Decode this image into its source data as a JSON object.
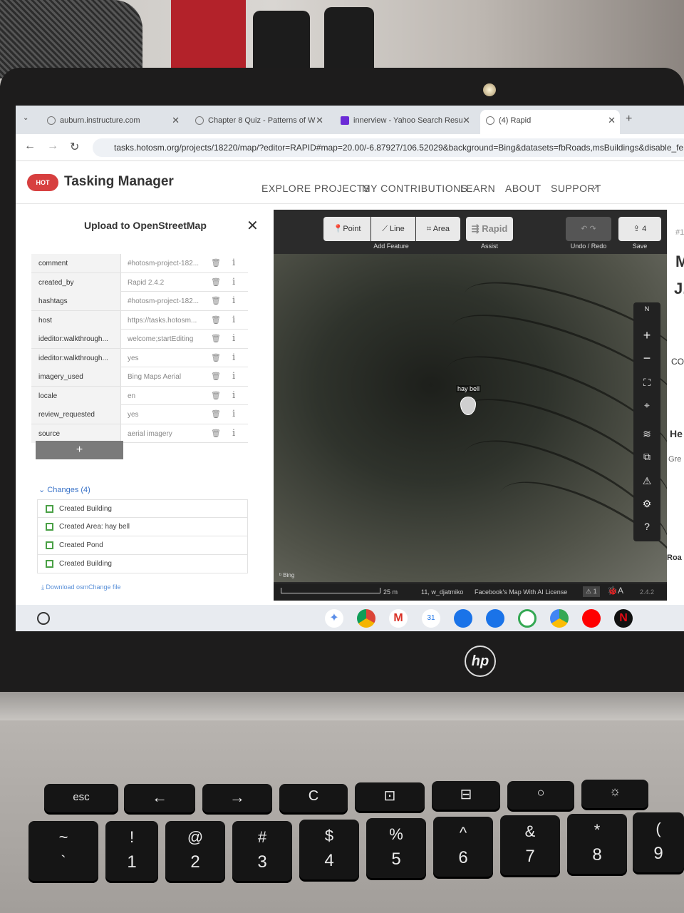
{
  "browser": {
    "tabs": [
      {
        "title": "auburn.instructure.com",
        "active": false
      },
      {
        "title": "Chapter 8 Quiz - Patterns of W",
        "active": false
      },
      {
        "title": "innerview - Yahoo Search Resu",
        "active": false
      },
      {
        "title": "(4) Rapid",
        "active": true
      }
    ],
    "url": "tasks.hotosm.org/projects/18220/map/?editor=RAPID#map=20.00/-6.87927/106.52029&background=Bing&datasets=fbRoads,msBuildings&disable_fe"
  },
  "header": {
    "logo_text": "HOT",
    "brand": "Tasking Manager",
    "nav": [
      "EXPLORE PROJECTS",
      "MY CONTRIBUTIONS",
      "LEARN",
      "ABOUT",
      "SUPPORT"
    ]
  },
  "panel": {
    "title": "Upload to OpenStreetMap",
    "tags": [
      {
        "key": "comment",
        "value": "#hotosm-project-182..."
      },
      {
        "key": "created_by",
        "value": "Rapid 2.4.2"
      },
      {
        "key": "hashtags",
        "value": "#hotosm-project-182..."
      },
      {
        "key": "host",
        "value": "https://tasks.hotosm..."
      },
      {
        "key": "ideditor:walkthrough...",
        "value": "welcome;startEditing"
      },
      {
        "key": "ideditor:walkthrough...",
        "value": "yes"
      },
      {
        "key": "imagery_used",
        "value": "Bing Maps Aerial"
      },
      {
        "key": "locale",
        "value": "en"
      },
      {
        "key": "review_requested",
        "value": "yes"
      },
      {
        "key": "source",
        "value": "aerial imagery"
      }
    ],
    "add_label": "+",
    "changes_header": "Changes (4)",
    "changes": [
      {
        "label": "Created Building",
        "name": ""
      },
      {
        "label": "Created Area:",
        "name": "hay bell"
      },
      {
        "label": "Created Pond",
        "name": ""
      },
      {
        "label": "Created Building",
        "name": ""
      }
    ],
    "download_label": "Download osmChange file"
  },
  "map": {
    "toolbar": {
      "point": "Point",
      "line": "Line",
      "area": "Area",
      "add_feature_label": "Add Feature",
      "rapid": "Rapid",
      "assist_label": "Assist",
      "undo_redo_label": "Undo / Redo",
      "save_count": "4",
      "save_label": "Save"
    },
    "pin_label": "hay bell",
    "attribution": "Bing",
    "footer": {
      "scale": "25 m",
      "user": "11, w_djatmiko",
      "license": "Facebook's Map With AI License",
      "issues": "1",
      "version": "2.4.2"
    },
    "controls": [
      "N",
      "+",
      "−"
    ]
  },
  "right_strip": [
    "#1",
    "M",
    "J.",
    "CO",
    "He",
    "Gre",
    "Roa"
  ],
  "keyboard": {
    "fn_row": [
      "esc",
      "←",
      "→",
      "C",
      "⊡",
      "⊟",
      "○",
      "☼"
    ],
    "num_row": [
      {
        "top": "~",
        "bottom": "`"
      },
      {
        "top": "!",
        "bottom": "1"
      },
      {
        "top": "@",
        "bottom": "2"
      },
      {
        "top": "#",
        "bottom": "3"
      },
      {
        "top": "$",
        "bottom": "4"
      },
      {
        "top": "%",
        "bottom": "5"
      },
      {
        "top": "^",
        "bottom": "6"
      },
      {
        "top": "&",
        "bottom": "7"
      },
      {
        "top": "*",
        "bottom": "8"
      },
      {
        "top": "(",
        "bottom": "9"
      }
    ]
  },
  "brand_laptop": "hp",
  "colors": {
    "hot_red": "#d73f3f",
    "link_blue": "#3a73c8",
    "building_green": "#49a045"
  }
}
